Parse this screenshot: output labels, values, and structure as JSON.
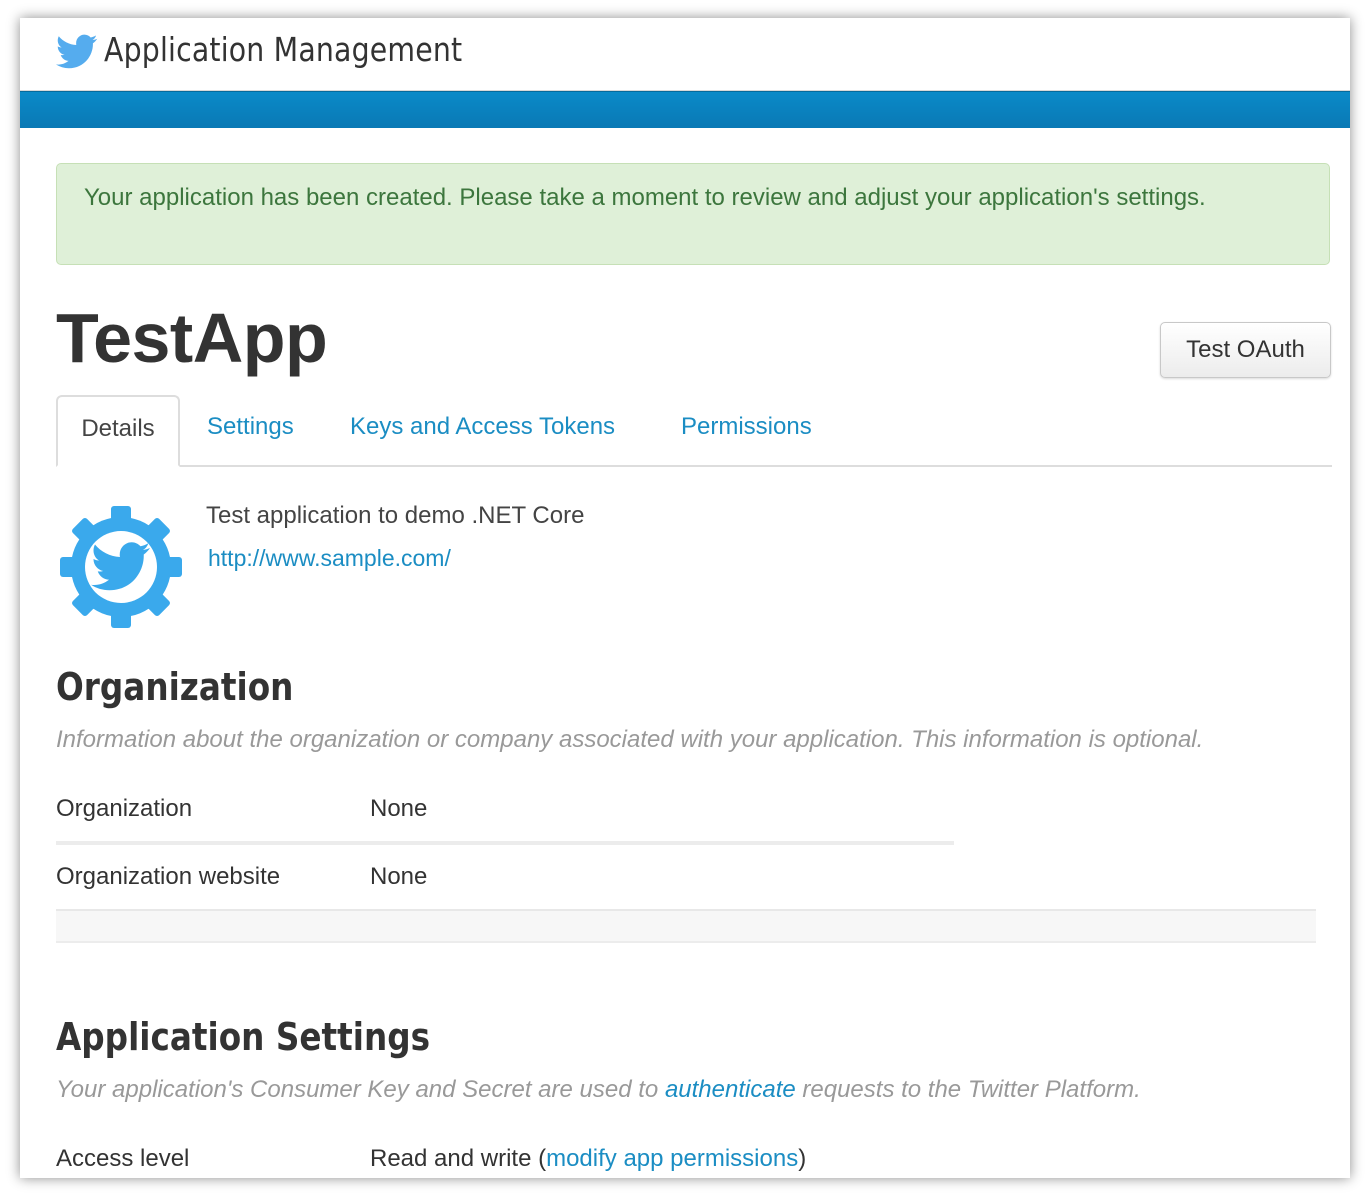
{
  "header": {
    "brand_icon": "twitter-bird-icon",
    "title": "Application Management",
    "accent_color": "#0a85c2"
  },
  "alert": {
    "message": "Your application has been created. Please take a moment to review and adjust your application's settings.",
    "color": "#3c763d",
    "background": "#dff0d8"
  },
  "app": {
    "name": "TestApp",
    "test_oauth_label": "Test OAuth",
    "icon": "twitter-gear-icon",
    "description": "Test application to demo .NET Core",
    "website": "http://www.sample.com/"
  },
  "tabs": [
    {
      "label": "Details",
      "active": true
    },
    {
      "label": "Settings",
      "active": false
    },
    {
      "label": "Keys and Access Tokens",
      "active": false
    },
    {
      "label": "Permissions",
      "active": false
    }
  ],
  "organization": {
    "title": "Organization",
    "subtitle": "Information about the organization or company associated with your application. This information is optional.",
    "rows": [
      {
        "label": "Organization",
        "value": "None"
      },
      {
        "label": "Organization website",
        "value": "None"
      }
    ]
  },
  "app_settings": {
    "title": "Application Settings",
    "subtitle_before": "Your application's Consumer Key and Secret are used to ",
    "subtitle_link": "authenticate",
    "subtitle_after": " requests to the Twitter Platform.",
    "access_level_label": "Access level",
    "access_level_value": "Read and write (",
    "access_level_link": "modify app permissions",
    "access_level_close": ")"
  },
  "colors": {
    "link": "#1b8dc3",
    "text": "#333333",
    "muted": "#999999"
  }
}
